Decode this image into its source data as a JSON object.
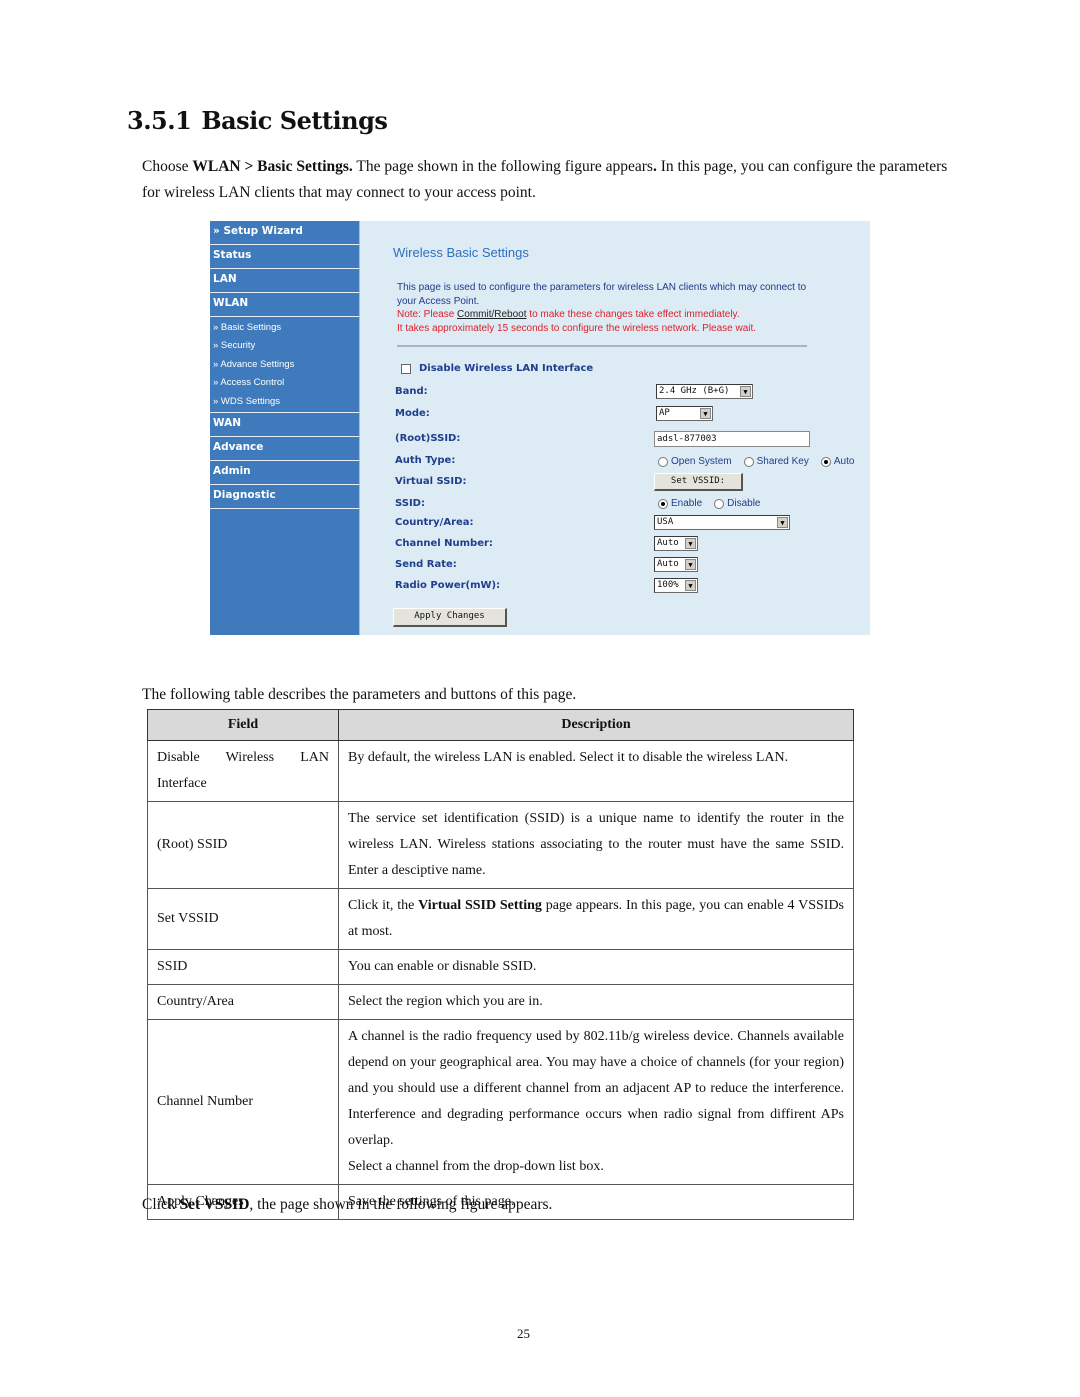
{
  "heading": {
    "number": "3.5.1",
    "title": "Basic Settings"
  },
  "intro": {
    "pre": "Choose ",
    "bold1": "WLAN > Basic Settings.",
    "mid": " The page shown in the following figure appears",
    "bold2": ".",
    "post": " In this page, you can configure the parameters for wireless LAN clients that may connect to your access point."
  },
  "router_ui": {
    "sidebar": {
      "items": [
        {
          "label": "» Setup Wizard"
        },
        {
          "label": "Status"
        },
        {
          "label": "LAN"
        },
        {
          "label": "WLAN"
        }
      ],
      "sub_items": [
        {
          "label": "» Basic Settings"
        },
        {
          "label": "» Security"
        },
        {
          "label": "» Advance Settings"
        },
        {
          "label": "» Access Control"
        },
        {
          "label": "» WDS Settings"
        }
      ],
      "items_after": [
        {
          "label": "WAN"
        },
        {
          "label": "Advance"
        },
        {
          "label": "Admin"
        },
        {
          "label": "Diagnostic"
        }
      ]
    },
    "title": "Wireless Basic Settings",
    "description": "This page is used to configure the parameters for wireless LAN clients which may connect to your Access Point.",
    "note_pre": "Note: Please ",
    "note_link": "Commit/Reboot",
    "note_post": " to make these changes take effect immediately.",
    "note2": "It takes approximately 15 seconds to configure the wireless network. Please wait.",
    "disable_label": "Disable Wireless LAN Interface",
    "disable_checked": false,
    "fields": {
      "band": {
        "label": "Band:",
        "value": "2.4 GHz (B+G)"
      },
      "mode": {
        "label": "Mode:",
        "value": "AP"
      },
      "root_ssid": {
        "label": "(Root)SSID:",
        "value": "adsl-877003"
      },
      "auth_type": {
        "label": "Auth Type:",
        "options": [
          "Open System",
          "Shared Key",
          "Auto"
        ],
        "selected": "Auto"
      },
      "virtual_ssid": {
        "label": "Virtual SSID:",
        "button": "Set VSSID:"
      },
      "ssid": {
        "label": "SSID:",
        "options": [
          "Enable",
          "Disable"
        ],
        "selected": "Enable"
      },
      "country": {
        "label": "Country/Area:",
        "value": "USA"
      },
      "channel": {
        "label": "Channel Number:",
        "value": "Auto"
      },
      "send_rate": {
        "label": "Send Rate:",
        "value": "Auto"
      },
      "radio_power": {
        "label": "Radio Power(mW):",
        "value": "100%"
      }
    },
    "apply_button": "Apply Changes",
    "dropdown_arrow": "▼"
  },
  "table_intro": "The following table describes the parameters and buttons of this page.",
  "table": {
    "headers": [
      "Field",
      "Description"
    ],
    "rows": [
      {
        "field": "Disable Wireless LAN Interface",
        "description": "By default, the wireless LAN is enabled. Select it to disable the wireless LAN."
      },
      {
        "field": "(Root) SSID",
        "description": "The service set identification (SSID) is a unique name to identify the router in the wireless LAN. Wireless stations associating to the router must have the same SSID. Enter a desciptive name."
      },
      {
        "field": "Set VSSID",
        "desc_pre": "Click it, the ",
        "desc_bold": "Virtual SSID Setting",
        "desc_post": " page appears. In this page, you can enable 4 VSSIDs at most."
      },
      {
        "field": "SSID",
        "description": "You can enable or disnable SSID."
      },
      {
        "field": "Country/Area",
        "description": "Select the region which you are in."
      },
      {
        "field": "Channel Number",
        "description": "A channel is the radio frequency used by 802.11b/g wireless device. Channels available depend on your geographical area. You may have a choice of channels (for your region) and you should use a different channel from an adjacent AP to reduce the interference. Interference and degrading performance occurs when radio signal from diffirent APs overlap.",
        "description2": "Select a channel from the drop-down list box."
      },
      {
        "field": "Apply Changes",
        "description": "Save the settings of this page."
      }
    ]
  },
  "outro": {
    "pre": "Click ",
    "bold": "Set VSSID",
    "post": ", the page shown in the following figure appears."
  },
  "page_number": "25"
}
